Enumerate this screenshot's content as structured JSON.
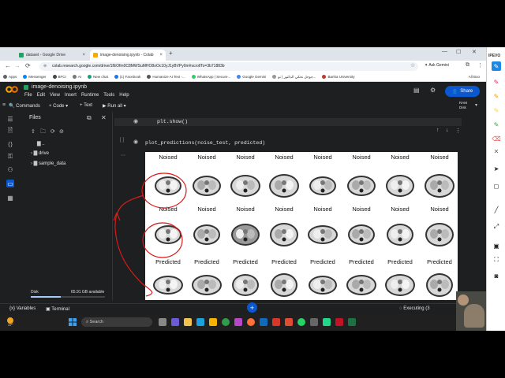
{
  "browser": {
    "tabs": [
      {
        "title": "dataset - Google Drive",
        "active": false
      },
      {
        "title": "image-denoising.ipynb - Colab",
        "active": true
      }
    ],
    "url": "colab.research.google.com/drive/1fEOfm0C8MWSuMHO8oOc10yJ1yBVPy0m#scrollTo=3b71883b",
    "ask_gemini": "Ask Gemini",
    "ipevo_label": "IPEVO",
    "bookmarks": [
      {
        "label": "Apps",
        "color": "#5f6368"
      },
      {
        "label": "Messenger",
        "color": "#0084ff"
      },
      {
        "label": "BFCI",
        "color": "#444444"
      },
      {
        "label": "AI",
        "color": "#777777"
      },
      {
        "label": "New chat",
        "color": "#10a37f"
      },
      {
        "label": "(1) Facebook",
        "color": "#1877f2"
      },
      {
        "label": "Humanize AI Text -...",
        "color": "#555555"
      },
      {
        "label": "WhatsApp | Secure...",
        "color": "#25d366"
      },
      {
        "label": "Google Gemini",
        "color": "#4285f4"
      },
      {
        "label": "جوجل نحكي الدكتور | نو...",
        "color": "#999999"
      },
      {
        "label": "Banha University",
        "color": "#c0392b"
      }
    ],
    "all_bookmarks": "All Boo"
  },
  "colab": {
    "notebook_title": "image-denoising.ipynb",
    "menu": [
      "File",
      "Edit",
      "View",
      "Insert",
      "Runtime",
      "Tools",
      "Help"
    ],
    "share_label": "Share",
    "commands_label": "Commands",
    "code_label": "+ Code",
    "text_label": "+ Text",
    "run_all_label": "Run all",
    "ram_label": "RAM",
    "disk_label": "Disk",
    "files_title": "Files",
    "file_tree": [
      "..",
      "drive",
      "sample_data"
    ],
    "disk_text": "Disk",
    "disk_available": "65.91 GB available",
    "cell_prev_code": "plt.show()",
    "cell_code": "plot_predictions(noise_test, predicted)",
    "row_labels": [
      "Noised",
      "Noised",
      "Predicted"
    ],
    "variables_label": "Variables",
    "terminal_label": "Terminal",
    "executing_label": "Executing (3"
  },
  "taskbar": {
    "search_placeholder": "Search",
    "temp": "17°"
  },
  "colors": {
    "colab_bg": "#1e1f20",
    "share_blue": "#0b57d0",
    "annotation_red": "#d81b1b"
  }
}
